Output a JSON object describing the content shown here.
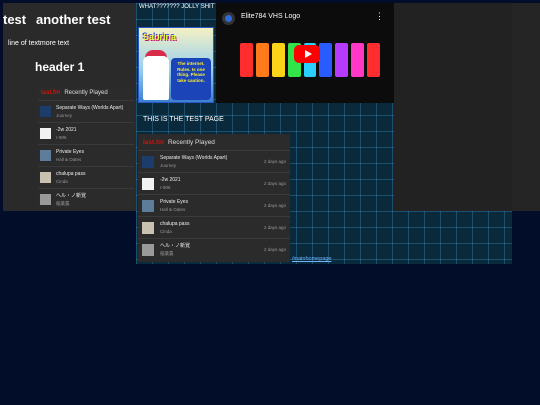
{
  "left": {
    "title1": "test",
    "title2": "another test",
    "line": "line of textmore text",
    "header": "header 1"
  },
  "center": {
    "jolly": "WHAT??????? JOLLY SHIT",
    "gif": {
      "logo": "Sabrina",
      "speech": "The internet. Rules. Is one thing. Please take caution."
    },
    "test_page": "THIS IS THE TEST PAGE",
    "link": "/mainhomepage"
  },
  "youtube": {
    "title": "Elite784 VHS Logo",
    "menu": "⋮",
    "bar_colors": [
      "#ff2d2d",
      "#ff7a1a",
      "#ffd21a",
      "#33e34a",
      "#2ad0ff",
      "#2a5bff",
      "#b63bff",
      "#ff38c6",
      "#ff2d2d"
    ]
  },
  "lastfm_small": {
    "logo": "last.fm",
    "label": "Recently Played",
    "tracks": [
      {
        "title": "Separate Ways (Worlds Apart)",
        "artist": "Journey"
      },
      {
        "title": "-2w 2021",
        "artist": "r-906"
      },
      {
        "title": "Private Eyes",
        "artist": "Hall & Oates"
      },
      {
        "title": "chalupa pass",
        "artist": "Cinda"
      },
      {
        "title": "ヘル・ノ新覚",
        "artist": "稲葉農"
      }
    ]
  },
  "lastfm_big": {
    "logo": "last.fm",
    "label": "Recently Played",
    "tracks": [
      {
        "title": "Separate Ways (Worlds Apart)",
        "artist": "Journey",
        "ago": "2 days ago"
      },
      {
        "title": "-2w 2021",
        "artist": "r-906",
        "ago": "2 days ago"
      },
      {
        "title": "Private Eyes",
        "artist": "Hall & Oates",
        "ago": "2 days ago"
      },
      {
        "title": "chalupa pass",
        "artist": "Cinda",
        "ago": "2 days ago"
      },
      {
        "title": "ヘル・ノ新覚",
        "artist": "稲葉農",
        "ago": "2 days ago"
      }
    ]
  }
}
